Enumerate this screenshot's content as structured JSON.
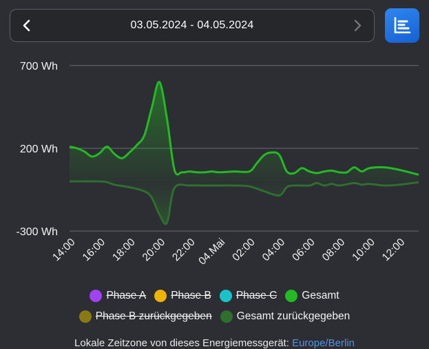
{
  "header": {
    "date_range": "03.05.2024 - 04.05.2024",
    "prev_icon": "chevron-left-icon",
    "next_icon": "chevron-right-icon",
    "chart_type_icon": "chart-bars-icon",
    "accent_color": "#1f74e0"
  },
  "chart_data": {
    "type": "line",
    "y_ticks": [
      "700 Wh",
      "200 Wh",
      "-300 Wh"
    ],
    "ylim": [
      -300,
      700
    ],
    "unit": "Wh",
    "x_tick_labels": [
      "14:00",
      "16:00",
      "18:00",
      "20:00",
      "22:00",
      "04.Mai",
      "02:00",
      "04:00",
      "06:00",
      "08:00",
      "10:00",
      "12:00"
    ],
    "x_tick_hours": [
      0,
      2,
      4,
      6,
      8,
      10,
      12,
      14,
      16,
      18,
      20,
      22
    ],
    "xlim_hours": [
      0,
      23.3
    ],
    "grid": true,
    "series": [
      {
        "name": "Gesamt",
        "color": "#22bb22",
        "x_hours": [
          0,
          0.5,
          1,
          1.5,
          2,
          2.5,
          3,
          3.5,
          4,
          4.5,
          5,
          5.5,
          6,
          6.5,
          7,
          7.5,
          8,
          8.5,
          9,
          9.5,
          10,
          11,
          12,
          12.5,
          13,
          13.5,
          14,
          14.5,
          15,
          15.5,
          16,
          16.5,
          17,
          17.5,
          18,
          18.5,
          19,
          19.5,
          20,
          21,
          22,
          23.3
        ],
        "values": [
          210,
          200,
          180,
          150,
          170,
          210,
          165,
          140,
          175,
          220,
          280,
          450,
          600,
          380,
          70,
          55,
          60,
          55,
          55,
          60,
          55,
          60,
          60,
          110,
          160,
          175,
          160,
          60,
          50,
          80,
          60,
          50,
          60,
          65,
          55,
          55,
          85,
          60,
          80,
          85,
          70,
          40
        ]
      },
      {
        "name": "Gesamt zurückgegeben",
        "color": "#2e6e2e",
        "x_hours": [
          0,
          2,
          2.5,
          3,
          4,
          5,
          5.5,
          6,
          6.5,
          7,
          8,
          9,
          10,
          11,
          12,
          13,
          14,
          14.5,
          15,
          16,
          16.5,
          17,
          17.5,
          18,
          19,
          19.5,
          20,
          21,
          22,
          23.3
        ],
        "values": [
          0,
          0,
          -5,
          -20,
          -35,
          -60,
          -100,
          -200,
          -250,
          -40,
          -25,
          -25,
          -25,
          -25,
          -30,
          -60,
          -85,
          -35,
          -25,
          -25,
          -10,
          -25,
          -15,
          -25,
          -10,
          -20,
          -15,
          -25,
          -20,
          -5
        ]
      }
    ]
  },
  "legend": {
    "row1": [
      {
        "label": "Phase A",
        "color": "#a142f4",
        "active": false
      },
      {
        "label": "Phase B",
        "color": "#f0b400",
        "active": false
      },
      {
        "label": "Phase C",
        "color": "#19c3c9",
        "active": false
      },
      {
        "label": "Gesamt",
        "color": "#22bb22",
        "active": true
      }
    ],
    "row2": [
      {
        "label": "Phase B zurückgegeben",
        "color": "#8a7a12",
        "active": false
      },
      {
        "label": "Gesamt zurückgegeben",
        "color": "#2e6e2e",
        "active": true
      }
    ]
  },
  "footer": {
    "timezone_prefix": "Lokale Zeitzone von dieses Energiemessgerät: ",
    "timezone_value": "Europe/Berlin"
  }
}
